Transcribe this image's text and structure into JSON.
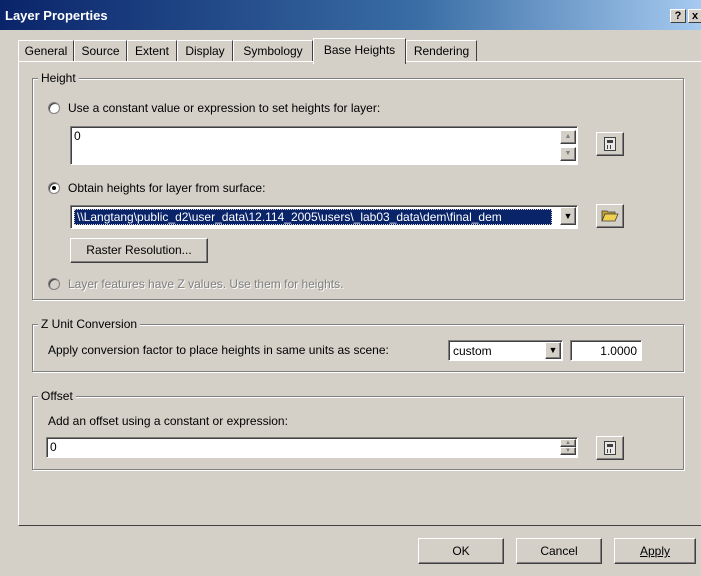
{
  "window": {
    "title": "Layer Properties",
    "help_glyph": "?",
    "close_glyph": "x"
  },
  "tabs": [
    {
      "label": "General",
      "active": false
    },
    {
      "label": "Source",
      "active": false
    },
    {
      "label": "Extent",
      "active": false
    },
    {
      "label": "Display",
      "active": false
    },
    {
      "label": "Symbology",
      "active": false
    },
    {
      "label": "Base Heights",
      "active": true
    },
    {
      "label": "Rendering",
      "active": false
    }
  ],
  "height_group": {
    "legend": "Height",
    "option_constant": "Use a constant value or expression to set heights for layer:",
    "constant_value": "0",
    "option_surface": "Obtain heights for layer from surface:",
    "surface_path": "\\\\Langtang\\public_d2\\user_data\\12.114_2005\\users\\_lab03_data\\dem\\final_dem",
    "raster_button": "Raster Resolution...",
    "option_z": "Layer features have Z values.  Use them for heights.",
    "selected": "surface"
  },
  "z_unit_group": {
    "legend": "Z Unit Conversion",
    "label": "Apply conversion factor to place heights in same units as scene:",
    "unit_value": "custom",
    "factor_value": "1.0000"
  },
  "offset_group": {
    "legend": "Offset",
    "label": "Add an offset using a constant or expression:",
    "value": "0"
  },
  "buttons": {
    "ok": "OK",
    "cancel": "Cancel",
    "apply": "Apply"
  },
  "icons": {
    "expression": "calculator-icon",
    "browse": "open-folder-icon",
    "dropdown": "triangle-down-icon",
    "spinner": "spinner-arrows-icon"
  },
  "colors": {
    "title_bar": "#0a246a",
    "dialog_face": "#d4d0c8",
    "selection": "#0a246a"
  }
}
